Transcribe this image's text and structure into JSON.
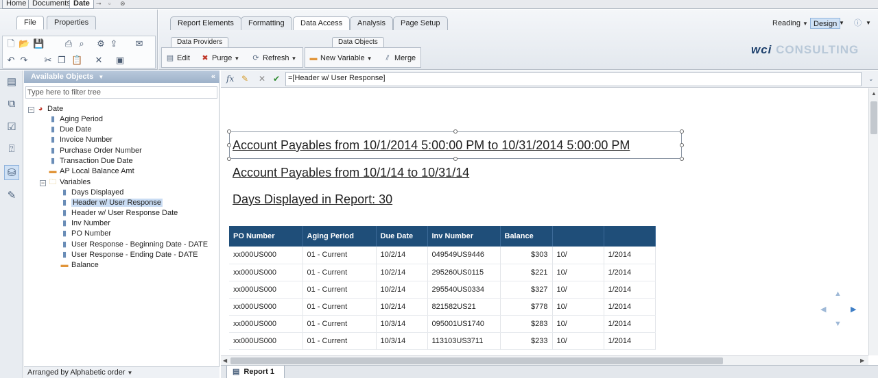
{
  "doc_tabs": {
    "home": "Home",
    "documents": "Documents",
    "current": "Date"
  },
  "left_ribbon": {
    "tab_file": "File",
    "tab_properties": "Properties"
  },
  "main_ribbon": {
    "tabs": [
      "Report Elements",
      "Formatting",
      "Data Access",
      "Analysis",
      "Page Setup"
    ],
    "active_tab": "Data Access",
    "subtab_data_providers": "Data Providers",
    "subtab_data_objects": "Data Objects",
    "edit": "Edit",
    "purge": "Purge",
    "refresh": "Refresh",
    "new_variable": "New Variable",
    "merge": "Merge",
    "reading": "Reading",
    "design": "Design",
    "logo_prefix": "wci",
    "logo_text": "CONSULTING"
  },
  "objects_panel": {
    "title": "Available Objects",
    "filter_placeholder": "Type here to filter tree",
    "root": "Date",
    "items": [
      "Aging Period",
      "Due Date",
      "Invoice Number",
      "Purchase Order Number",
      "Transaction Due Date"
    ],
    "measure": "AP Local Balance Amt",
    "folder": "Variables",
    "variables": [
      "Days Displayed",
      "Header w/ User Response",
      "Header w/ User Response Date",
      "Inv Number",
      "PO Number",
      "User Response - Beginning Date - DATE",
      "User Response - Ending Date - DATE"
    ],
    "variable_measure": "Balance",
    "footer": "Arranged by Alphabetic order"
  },
  "formula": {
    "value": "=[Header w/ User Response]"
  },
  "report": {
    "title1": "Account Payables from 10/1/2014 5:00:00 PM to 10/31/2014 5:00:00 PM",
    "title2": "Account Payables from 10/1/14 to 10/31/14",
    "title3": "Days Displayed in Report:  30",
    "columns": [
      "PO Number",
      "Aging Period",
      "Due Date",
      "Inv Number",
      "Balance",
      "",
      ""
    ],
    "rows": [
      [
        "xx000US000",
        "01 - Current",
        "10/2/14",
        "049549US9446",
        "$303",
        "10/",
        "1/2014"
      ],
      [
        "xx000US000",
        "01 - Current",
        "10/2/14",
        "295260US0115",
        "$221",
        "10/",
        "1/2014"
      ],
      [
        "xx000US000",
        "01 - Current",
        "10/2/14",
        "295540US0334",
        "$327",
        "10/",
        "1/2014"
      ],
      [
        "xx000US000",
        "01 - Current",
        "10/2/14",
        "821582US21",
        "$778",
        "10/",
        "1/2014"
      ],
      [
        "xx000US000",
        "01 - Current",
        "10/3/14",
        "095001US1740",
        "$283",
        "10/",
        "1/2014"
      ],
      [
        "xx000US000",
        "01 - Current",
        "10/3/14",
        "113103US3711",
        "$233",
        "10/",
        "1/2014"
      ]
    ]
  },
  "bottom": {
    "report_tab": "Report 1"
  }
}
